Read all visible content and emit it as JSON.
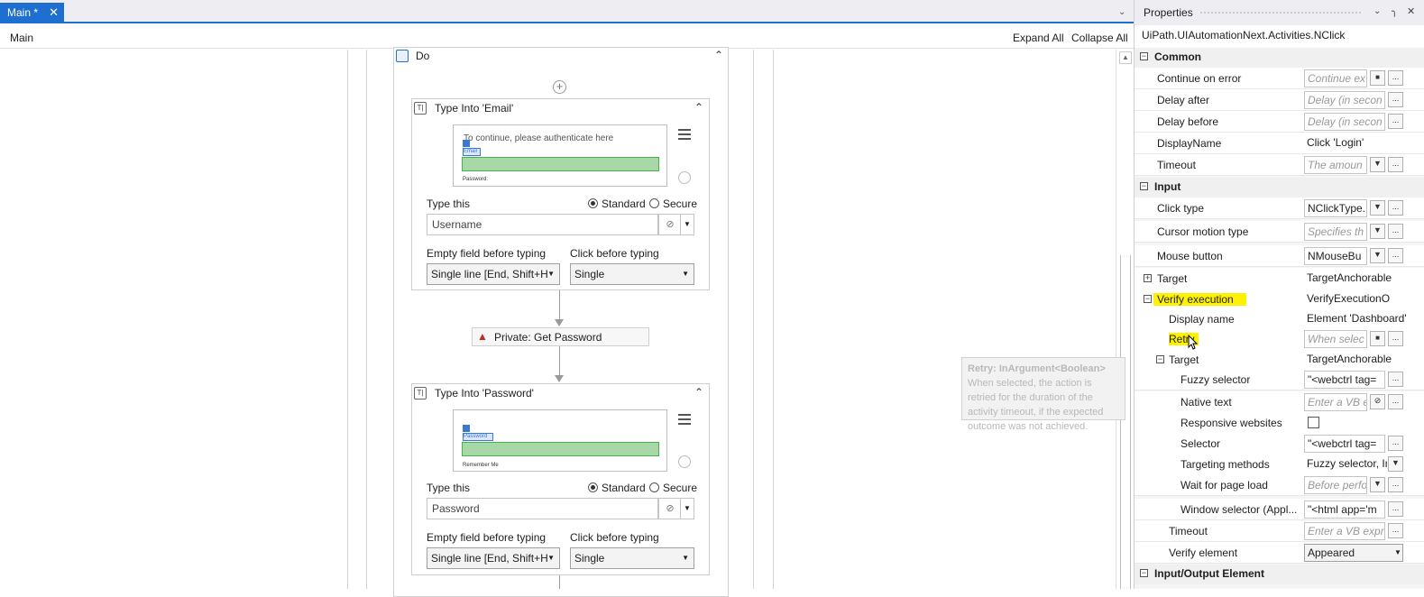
{
  "tabs": {
    "main_tab": "Main *",
    "close": "✕"
  },
  "breadcrumb": {
    "root": "Main"
  },
  "toolbar": {
    "expand_all": "Expand All",
    "collapse_all": "Collapse All"
  },
  "sequence": {
    "title": "Do"
  },
  "type_email": {
    "title": "Type Into 'Email'",
    "preview_text": "To continue, please authenticate here",
    "preview_tag": "Email",
    "preview_footer": "Password:",
    "type_this": "Type this",
    "mode_standard": "Standard",
    "mode_secure": "Secure",
    "value": "Username",
    "empty_field_label": "Empty field before typing",
    "empty_field_value": "Single line [End, Shift+H",
    "click_before_label": "Click before typing",
    "click_before_value": "Single"
  },
  "private_activity": {
    "label": "Private: Get Password"
  },
  "type_password": {
    "title": "Type Into 'Password'",
    "preview_tag": "Password",
    "preview_footer": "Remember Me",
    "type_this": "Type this",
    "mode_standard": "Standard",
    "mode_secure": "Secure",
    "value": "Password",
    "empty_field_label": "Empty field before typing",
    "empty_field_value": "Single line [End, Shift+H",
    "click_before_label": "Click before typing",
    "click_before_value": "Single"
  },
  "properties": {
    "title": "Properties",
    "type_name": "UiPath.UIAutomationNext.Activities.NClick",
    "cat_common": "Common",
    "cat_input": "Input",
    "cat_io": "Input/Output Element",
    "rows": [
      {
        "name": "Continue on error",
        "value": "Continue ex"
      },
      {
        "name": "Delay after",
        "value": "Delay (in secon"
      },
      {
        "name": "Delay before",
        "value": "Delay (in secon"
      },
      {
        "name": "DisplayName",
        "value": "Click 'Login'"
      },
      {
        "name": "Timeout",
        "value": "The amoun"
      },
      {
        "name": "Click type",
        "value": "NClickType."
      },
      {
        "name": "Cursor motion type",
        "value": "Specifies th"
      },
      {
        "name": "Mouse button",
        "value": "NMouseBu"
      },
      {
        "name": "Target",
        "value": "TargetAnchorable"
      },
      {
        "name": "Verify execution",
        "value": "VerifyExecutionO"
      },
      {
        "name": "Display name",
        "value": "Element 'Dashboard'"
      },
      {
        "name": "Retry",
        "value": "When selec"
      },
      {
        "name": "Target",
        "value": "TargetAnchorable"
      },
      {
        "name": "Fuzzy selector",
        "value": "\"<webctrl tag="
      },
      {
        "name": "Native text",
        "value": "Enter a VB e"
      },
      {
        "name": "Responsive websites",
        "value": ""
      },
      {
        "name": "Selector",
        "value": "\"<webctrl tag="
      },
      {
        "name": "Targeting methods",
        "value": "Fuzzy selector, In"
      },
      {
        "name": "Wait for page load",
        "value": "Before perfo"
      },
      {
        "name": "Window selector (Appl...",
        "value": "\"<html app='m"
      },
      {
        "name": "Timeout",
        "value": "Enter a VB expr"
      },
      {
        "name": "Verify element",
        "value": "Appeared"
      }
    ]
  },
  "tooltip": {
    "title": "Retry: InArgument<Boolean>",
    "body": "When selected, the action is retried for the duration of the activity timeout, if the expected outcome was not achieved."
  }
}
